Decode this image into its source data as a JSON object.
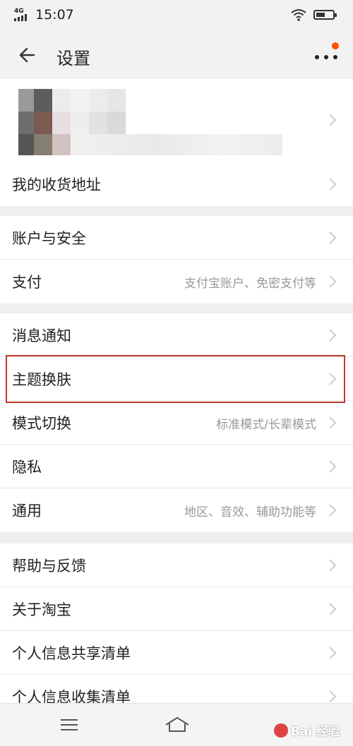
{
  "status_bar": {
    "network": "4G",
    "time": "15:07"
  },
  "header": {
    "title": "设置"
  },
  "groups": [
    {
      "rows": [
        {
          "label": "我的收货地址",
          "value": ""
        }
      ]
    },
    {
      "rows": [
        {
          "label": "账户与安全",
          "value": ""
        },
        {
          "label": "支付",
          "value": "支付宝账户、免密支付等"
        }
      ]
    },
    {
      "rows": [
        {
          "label": "消息通知",
          "value": ""
        },
        {
          "label": "主题换肤",
          "value": ""
        },
        {
          "label": "模式切换",
          "value": "标准模式/长辈模式"
        },
        {
          "label": "隐私",
          "value": ""
        },
        {
          "label": "通用",
          "value": "地区、音效、辅助功能等"
        }
      ]
    },
    {
      "rows": [
        {
          "label": "帮助与反馈",
          "value": ""
        },
        {
          "label": "关于淘宝",
          "value": ""
        },
        {
          "label": "个人信息共享清单",
          "value": ""
        },
        {
          "label": "个人信息收集清单",
          "value": ""
        }
      ]
    }
  ],
  "watermark": {
    "text": "Bai 经验"
  },
  "icons": {
    "back": "arrow-left-icon",
    "more": "more-dots-icon",
    "chevron": "chevron-right-icon",
    "menu": "menu-icon",
    "home": "home-icon",
    "wifi": "wifi-icon",
    "battery": "battery-icon"
  },
  "colors": {
    "accent": "#ff5000",
    "highlight_border": "#c0392b",
    "text": "#222222",
    "secondary": "#999999",
    "background": "#efefef"
  }
}
